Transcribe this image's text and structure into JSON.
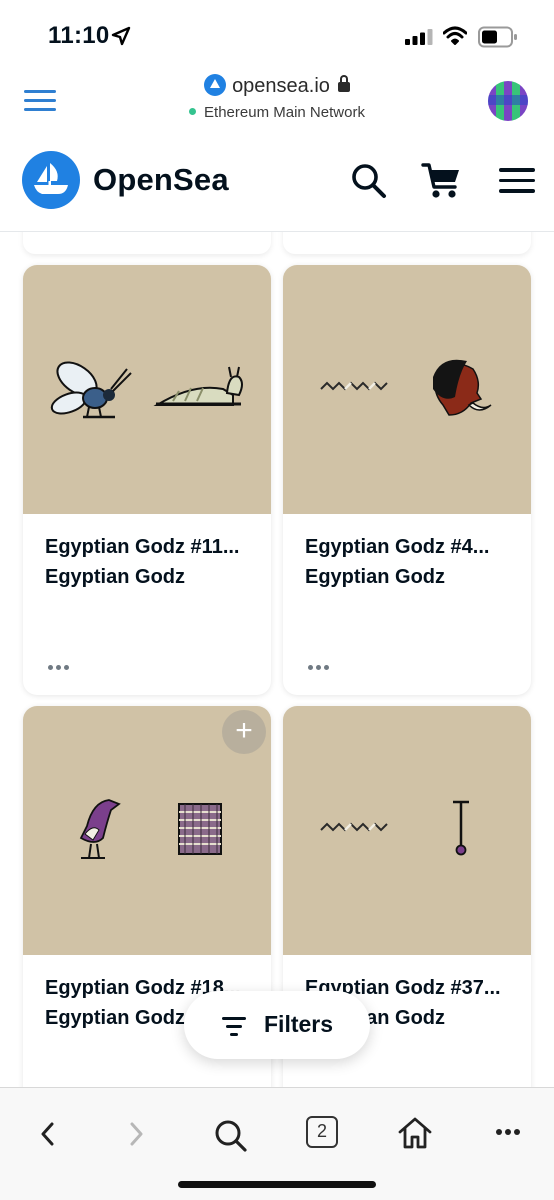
{
  "status_bar": {
    "time": "11:10"
  },
  "browser": {
    "domain": "opensea.io",
    "network": "Ethereum Main Network",
    "tabs_count": "2"
  },
  "header": {
    "brand": "OpenSea"
  },
  "cards": [
    {
      "title": "Egyptian Godz #11...",
      "collection": "Egyptian Godz"
    },
    {
      "title": "Egyptian Godz #4...",
      "collection": "Egyptian Godz"
    },
    {
      "title": "Egyptian Godz #18...",
      "collection": "Egyptian Godz"
    },
    {
      "title": "Egyptian Godz #37...",
      "collection": "Egyptian Godz"
    }
  ],
  "filters": {
    "label": "Filters"
  },
  "colors": {
    "brand_blue": "#2081e2",
    "card_image_bg": "#d0c2a6",
    "network_dot": "#34c38f"
  },
  "icons": [
    "location-arrow-icon",
    "signal-icon",
    "wifi-icon",
    "battery-icon",
    "browser-menu-icon",
    "opensea-logo-icon",
    "lock-icon",
    "search-icon",
    "cart-icon",
    "menu-icon",
    "more-icon",
    "plus-icon",
    "filter-icon",
    "back-icon",
    "forward-icon",
    "tabs-icon",
    "home-icon"
  ]
}
